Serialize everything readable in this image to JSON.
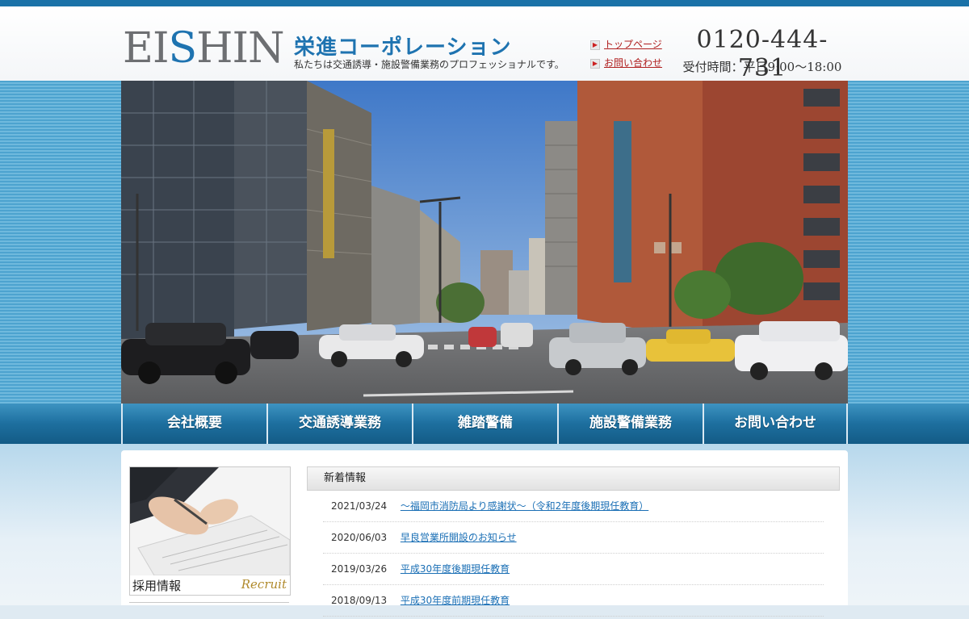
{
  "header": {
    "logo_latin_prefix": "EI",
    "logo_latin_accent": "S",
    "logo_latin_suffix": "HIN",
    "logo_japanese": "栄進コーポレーション",
    "tagline": "私たちは交通誘導・施設警備業務のプロフェッショナルです。",
    "links": [
      {
        "label": "トップページ",
        "icon": "arrow-right-icon"
      },
      {
        "label": "お問い合わせ",
        "icon": "arrow-right-icon"
      }
    ],
    "phone": "0120-444-731",
    "hours": "受付時間：平日9:00～18:00"
  },
  "hero": {
    "image": "city-intersection-photo"
  },
  "nav": {
    "items": [
      {
        "label": "会社概要"
      },
      {
        "label": "交通誘導業務"
      },
      {
        "label": "雑踏警備"
      },
      {
        "label": "施設警備業務"
      },
      {
        "label": "お問い合わせ"
      }
    ]
  },
  "sidebar": {
    "recruit_banner": {
      "label_jp": "採用情報",
      "label_en": "Recruit",
      "image": "hands-writing-document-photo"
    }
  },
  "news": {
    "title": "新着情報",
    "items": [
      {
        "date": "2021/03/24",
        "title": "～福岡市消防局より感謝状～（令和2年度後期現任教育）"
      },
      {
        "date": "2020/06/03",
        "title": "早良営業所開設のお知らせ"
      },
      {
        "date": "2019/03/26",
        "title": "平成30年度後期現任教育"
      },
      {
        "date": "2018/09/13",
        "title": "平成30年度前期現任教育"
      }
    ]
  },
  "colors": {
    "brand_blue": "#1e73b0",
    "nav_blue": "#1d6f9f",
    "link_red": "#b01f1f",
    "link_blue": "#1a6fb5"
  }
}
